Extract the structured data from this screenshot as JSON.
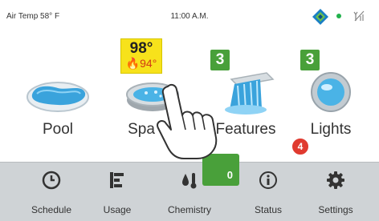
{
  "status_bar": {
    "air_temp": "Air Temp 58° F",
    "time": "11:00 A.M."
  },
  "tiles": [
    {
      "id": "pool",
      "label": "Pool"
    },
    {
      "id": "spa",
      "label": "Spa",
      "set_temp": "98°",
      "actual_temp": "94°"
    },
    {
      "id": "features",
      "label": "Features",
      "count": "3"
    },
    {
      "id": "lights",
      "label": "Lights",
      "count": "3"
    }
  ],
  "nav": [
    {
      "label": "Schedule",
      "icon": "clock-icon"
    },
    {
      "label": "Usage",
      "icon": "bars-icon"
    },
    {
      "label": "Chemistry",
      "icon": "droplet-thermometer-icon",
      "badge": "0"
    },
    {
      "label": "Status",
      "icon": "info-icon",
      "badge": "4"
    },
    {
      "label": "Settings",
      "icon": "gear-icon"
    }
  ],
  "colors": {
    "badge_green": "#49a03a",
    "alert_red": "#e03a2f",
    "temp_yellow": "#f7e21b",
    "nav_bg": "#cfd3d6"
  }
}
